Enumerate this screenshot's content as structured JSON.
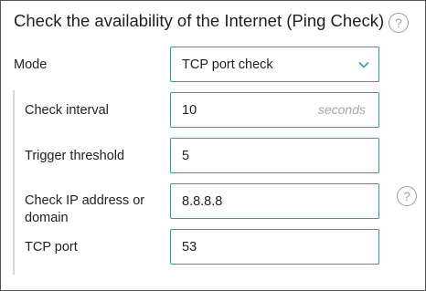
{
  "panel": {
    "title": "Check the availability of the Internet (Ping Check)",
    "help_glyph": "?"
  },
  "mode": {
    "label": "Mode",
    "selected": "TCP port check"
  },
  "check_interval": {
    "label": "Check interval",
    "value": "10",
    "suffix": "seconds"
  },
  "trigger_threshold": {
    "label": "Trigger threshold",
    "value": "5"
  },
  "check_ip": {
    "label": "Check IP address or domain",
    "value": "8.8.8.8",
    "help_glyph": "?"
  },
  "tcp_port": {
    "label": "TCP port",
    "value": "53"
  },
  "colors": {
    "field_border": "#26a69a",
    "help_icon": "#9e9e9e",
    "panel_border": "#555555"
  }
}
